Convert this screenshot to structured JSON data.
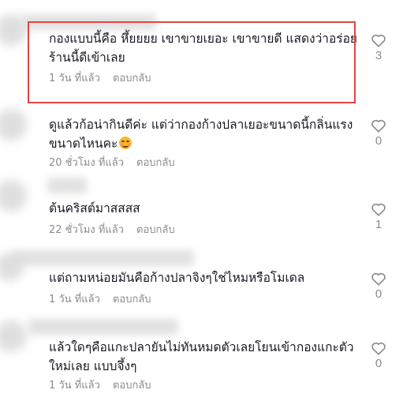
{
  "comments": [
    {
      "text_line1": "กองแบบนี้คือ หึ้ยยยย เขาขายเยอะ เขาขายดี แสดงว่าอร่อย",
      "text_line2": "ร้านนี้ดีเข้าเลย",
      "time": "1 วัน ที่แล้ว",
      "reply": "ตอบกลับ",
      "likes": "3"
    },
    {
      "text_line1": "ดูแล้วก้อน่ากินดีค่ะ แต่ว่ากองก้างปลาเยอะขนาดนี้กลิ่นแรง",
      "text_line2": "ขนาดไหนคะ",
      "emoji": "smiling-face-emoji",
      "time": "20 ชั่วโมง ที่แล้ว",
      "reply": "ตอบกลับ",
      "likes": "0"
    },
    {
      "text_line1": "ต้นคริสต์มาสสสส",
      "time": "22 ชั่วโมง ที่แล้ว",
      "reply": "ตอบกลับ",
      "likes": "1"
    },
    {
      "text_line1": "แต่ถามหน่อยมันคือก้างปลาจิงๆใช่ไหมหรือโมเดล",
      "time": "1 วัน ที่แล้ว",
      "reply": "ตอบกลับ",
      "likes": "0"
    },
    {
      "text_line1": "แล้วใดๆคือแกะปลายันไม่ทันหมดตัวเลยโยนเข้ากองแกะตัว",
      "text_line2": "ใหม่เลย แบบจึ้งๆ",
      "time": "1 วัน ที่แล้ว",
      "reply": "ตอบกลับ",
      "likes": "0"
    }
  ],
  "highlight_color": "#e04545",
  "icons": {
    "like": "heart-outline-icon"
  }
}
